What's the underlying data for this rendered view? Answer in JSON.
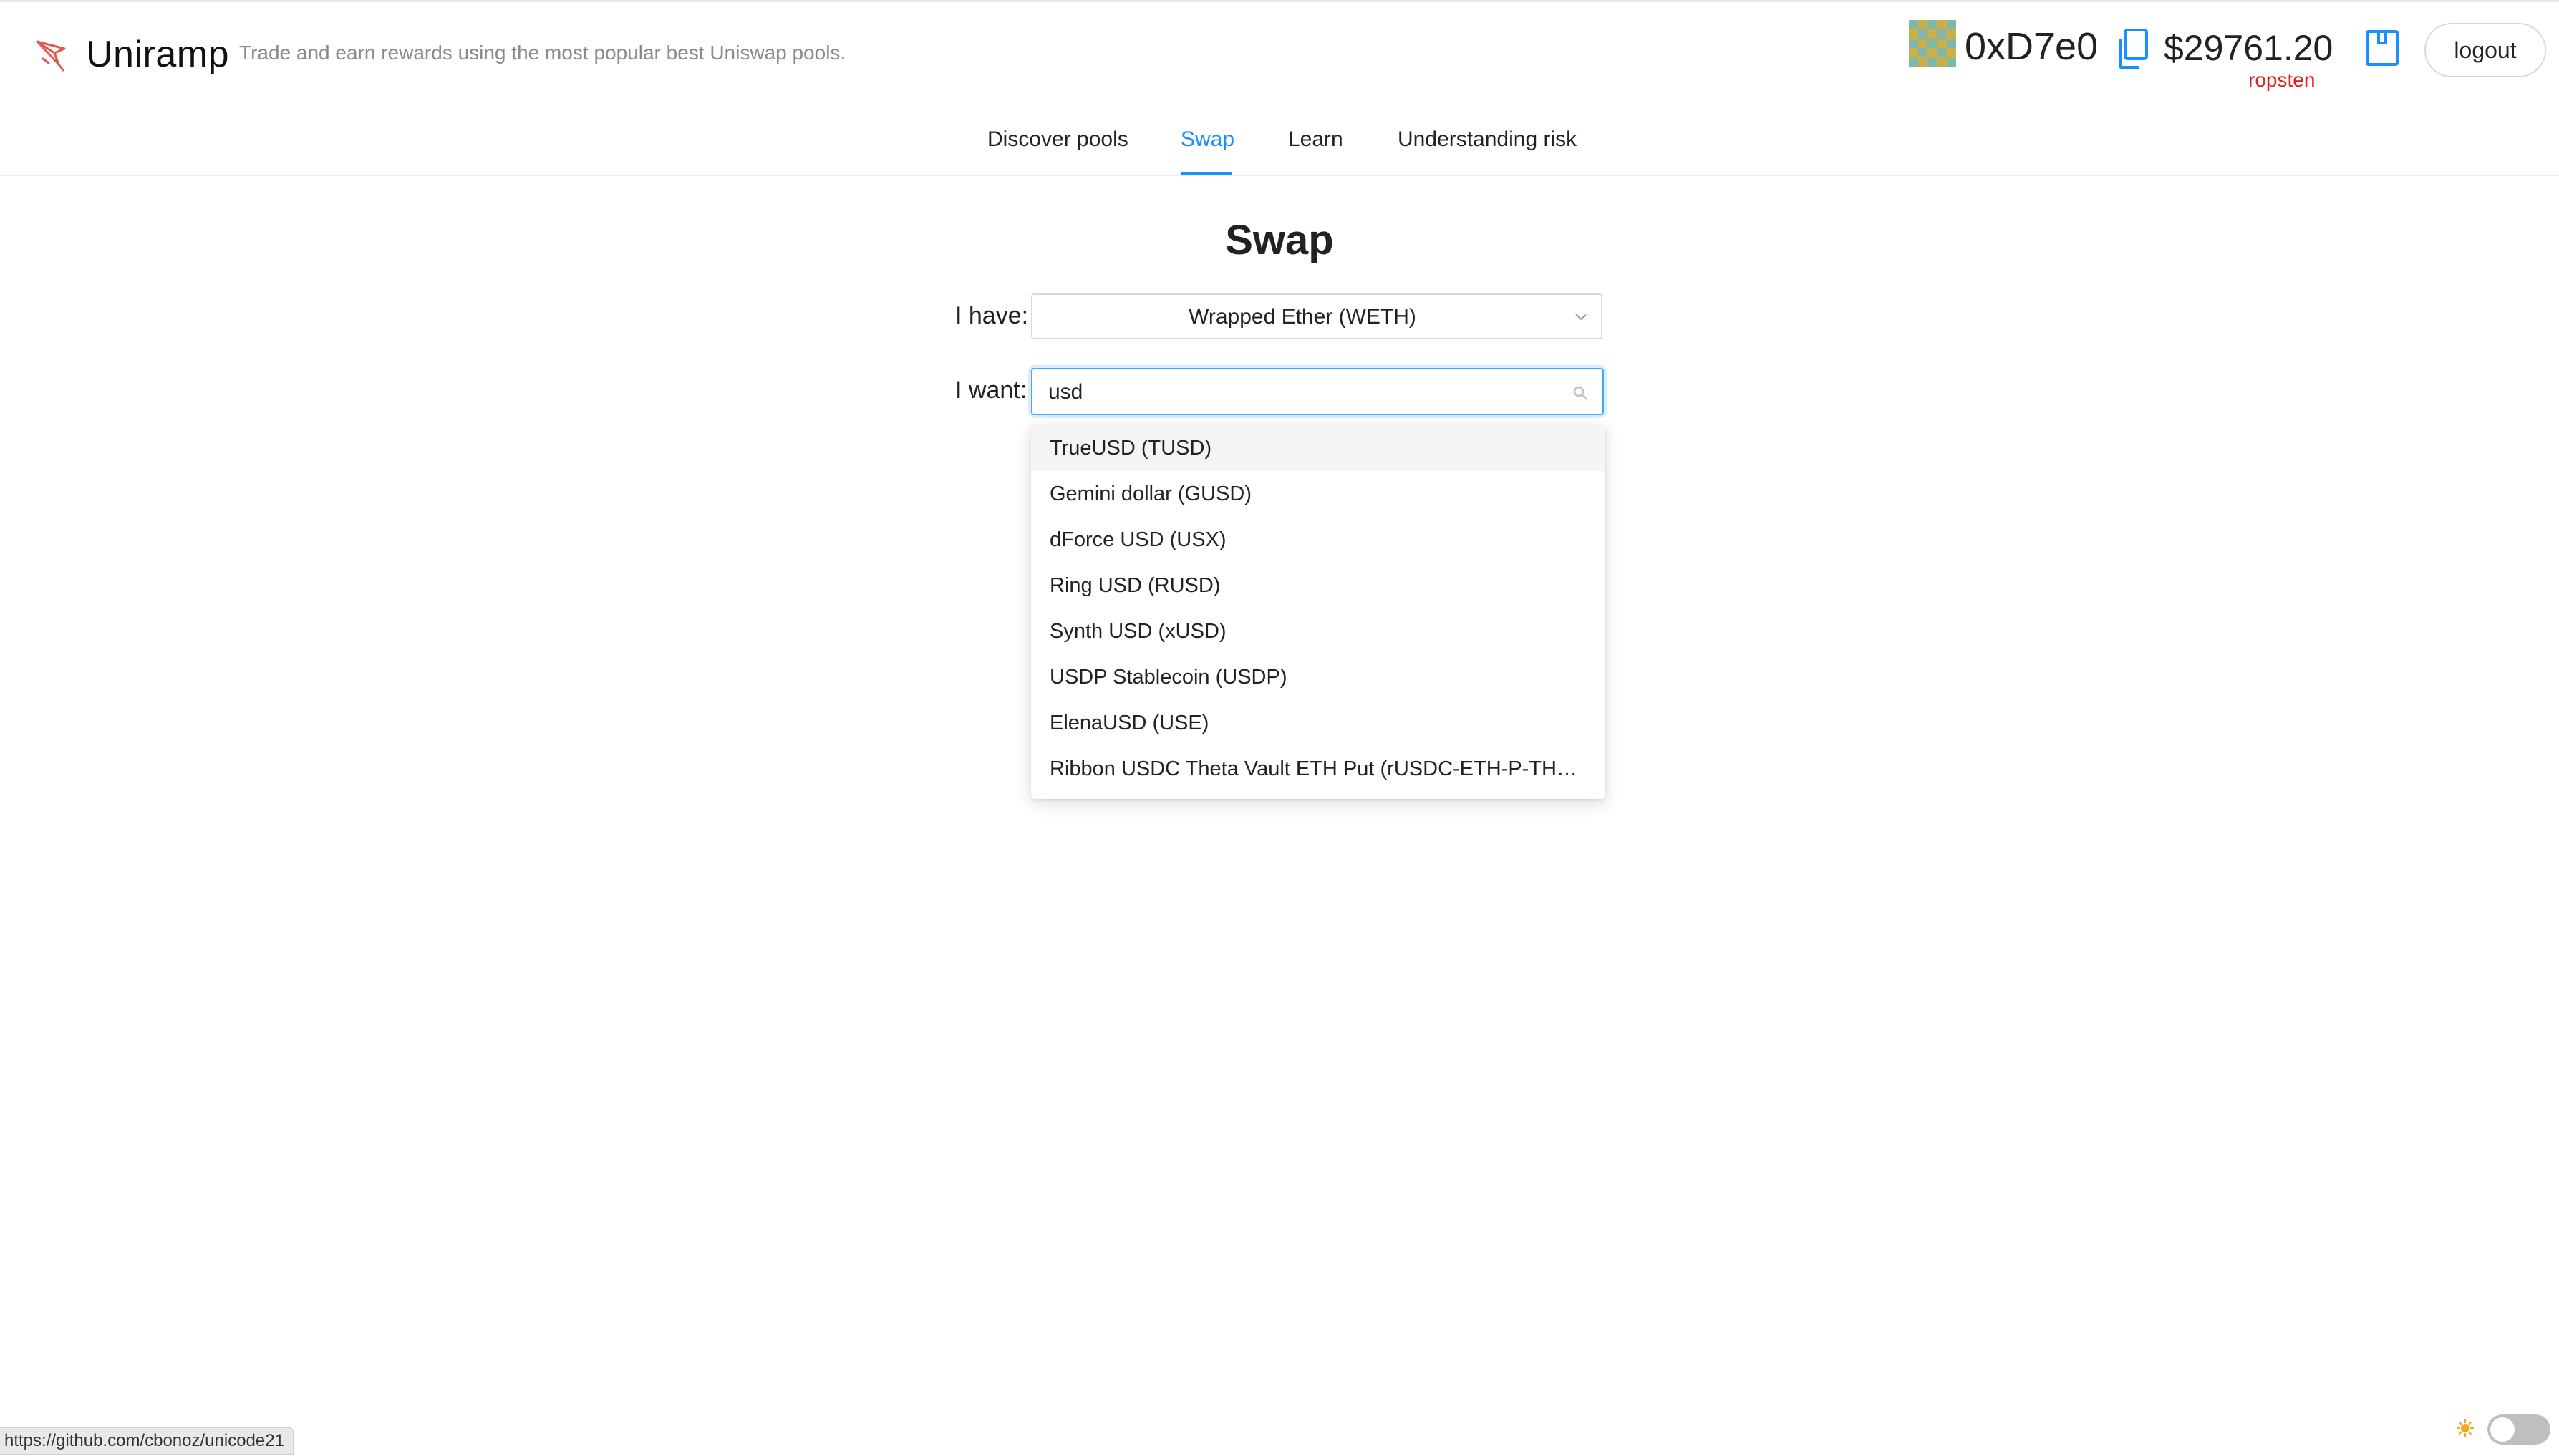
{
  "app": {
    "brand": "Uniramp",
    "tagline": "Trade and earn rewards using the most popular best Uniswap pools."
  },
  "account": {
    "address": "0xD7e0",
    "balance": "$29761.20",
    "network": "ropsten",
    "logout_label": "logout"
  },
  "nav": {
    "items": [
      {
        "label": "Discover pools"
      },
      {
        "label": "Swap",
        "active": true
      },
      {
        "label": "Learn"
      },
      {
        "label": "Understanding risk"
      }
    ]
  },
  "swap": {
    "title": "Swap",
    "have_label": "I have:",
    "have_value": "Wrapped Ether (WETH)",
    "want_label": "I want:",
    "want_query": "usd",
    "options": [
      "TrueUSD (TUSD)",
      "Gemini dollar (GUSD)",
      "dForce USD (USX)",
      "Ring USD (RUSD)",
      "Synth USD (xUSD)",
      "USDP Stablecoin (USDP)",
      "ElenaUSD (USE)",
      "Ribbon USDC Theta Vault ETH Put (rUSDC-ETH-P-THETA)"
    ],
    "hovered_option": 0
  },
  "footer": {
    "status_url": "https://github.com/cbonoz/unicode21"
  },
  "colors": {
    "accent": "#1890ff",
    "network": "#e0201e",
    "logo": "#e05a4f"
  },
  "icons": {
    "logo": "rocket-logo-icon",
    "avatar": "identicon-avatar",
    "copy": "copy-icon",
    "wallet": "wallet-icon",
    "select": "chevron-down-icon",
    "search": "search-icon",
    "theme": "sun-icon"
  }
}
